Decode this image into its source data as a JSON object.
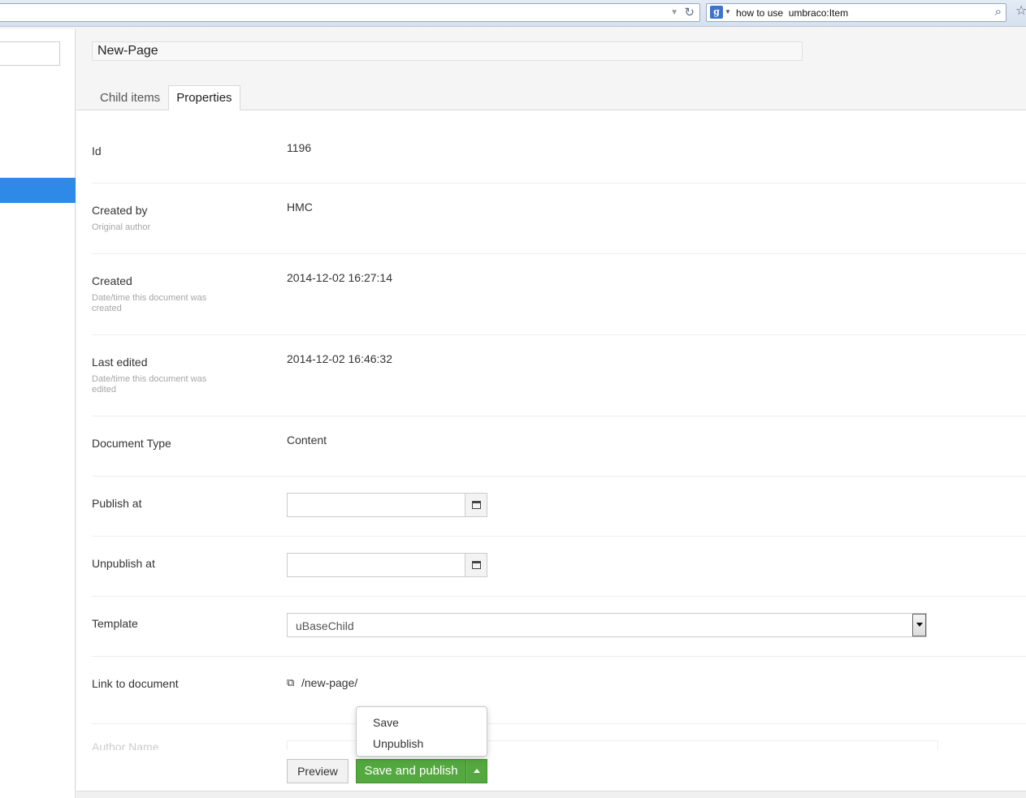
{
  "browser": {
    "search_query": "how to use  umbraco:Item"
  },
  "header": {
    "document_name": "New-Page",
    "tabs": [
      {
        "label": "Child items",
        "active": false
      },
      {
        "label": "Properties",
        "active": true
      }
    ]
  },
  "properties": {
    "id": {
      "label": "Id",
      "value": "1196"
    },
    "created_by": {
      "label": "Created by",
      "description": "Original author",
      "value": "HMC"
    },
    "created": {
      "label": "Created",
      "description": "Date/time this document was created",
      "value": "2014-12-02 16:27:14"
    },
    "last_edited": {
      "label": "Last edited",
      "description": "Date/time this document was edited",
      "value": "2014-12-02 16:46:32"
    },
    "document_type": {
      "label": "Document Type",
      "value": "Content"
    },
    "publish_at": {
      "label": "Publish at",
      "value": ""
    },
    "unpublish_at": {
      "label": "Unpublish at",
      "value": ""
    },
    "template": {
      "label": "Template",
      "value": "uBaseChild"
    },
    "link": {
      "label": "Link to document",
      "value": "/new-page/"
    },
    "faded_next_label": "Author Name"
  },
  "actions": {
    "preview_label": "Preview",
    "publish_label": "Save and publish",
    "menu": {
      "save_label": "Save",
      "unpublish_label": "Unpublish"
    }
  },
  "colors": {
    "accent_blue": "#2e8ae6",
    "publish_green": "#53a93f"
  }
}
